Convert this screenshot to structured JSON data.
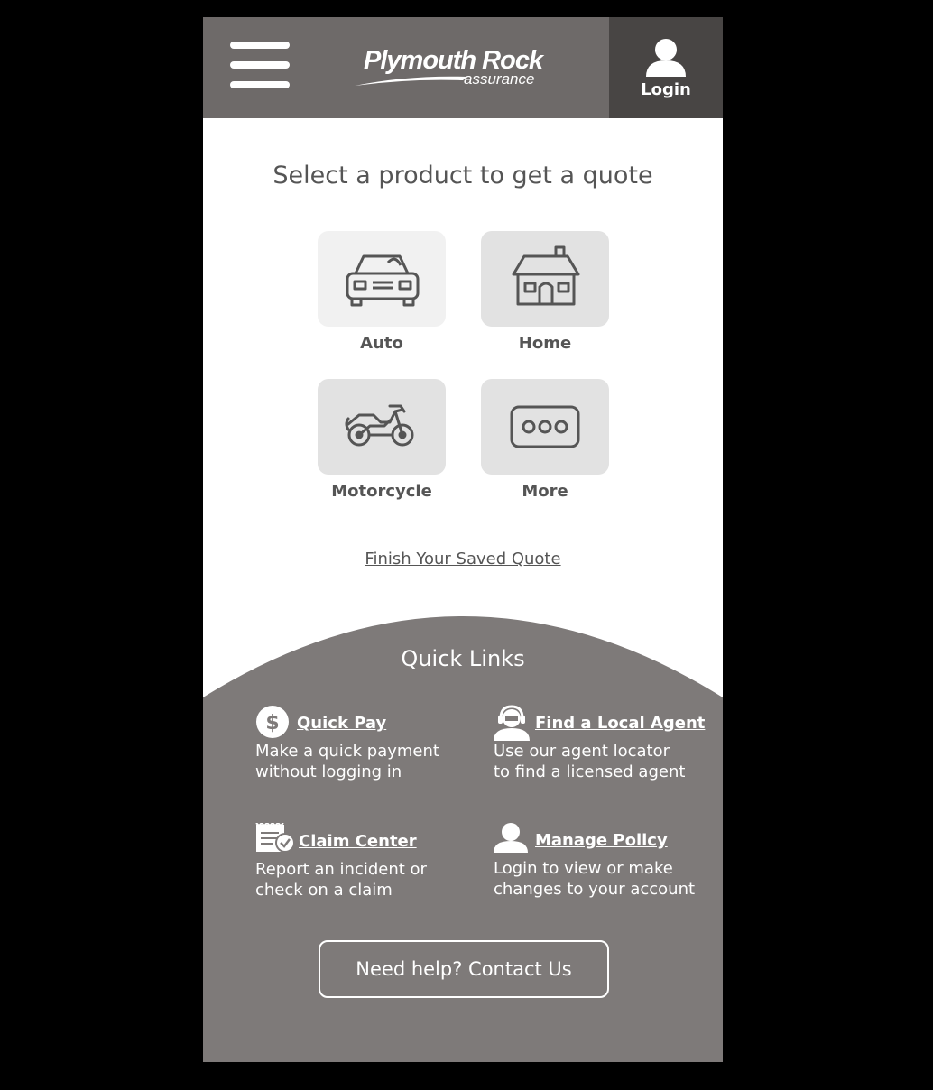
{
  "header": {
    "logo_brand": "Plymouth Rock",
    "logo_tagline": "assurance",
    "login_label": "Login"
  },
  "main": {
    "title": "Select a product to get a quote",
    "products": [
      {
        "label": "Auto",
        "icon": "car-icon"
      },
      {
        "label": "Home",
        "icon": "house-icon"
      },
      {
        "label": "Motorcycle",
        "icon": "motorcycle-icon"
      },
      {
        "label": "More",
        "icon": "more-icon"
      }
    ],
    "saved_quote_link": "Finish Your Saved Quote"
  },
  "quick_links": {
    "title": "Quick Links",
    "items": [
      {
        "label": "Quick Pay",
        "desc_line1": "Make a quick payment",
        "desc_line2": "without logging in",
        "icon": "dollar-icon"
      },
      {
        "label": "Find a Local Agent",
        "desc_line1": "Use our agent locator",
        "desc_line2": "to find a licensed agent",
        "icon": "agent-headset-icon"
      },
      {
        "label": "Claim Center",
        "desc_line1": "Report an incident or",
        "desc_line2": "check on a claim",
        "icon": "claim-document-icon"
      },
      {
        "label": "Manage Policy",
        "desc_line1": "Login to view or make",
        "desc_line2": "changes to your account",
        "icon": "user-icon"
      }
    ],
    "contact_button": "Need help? Contact Us"
  },
  "colors": {
    "header_bg": "#6e6a69",
    "login_bg": "#484544",
    "quick_links_bg": "#7e7a79",
    "tile_bg": "#e2e2e2",
    "text_gray": "#555555"
  }
}
